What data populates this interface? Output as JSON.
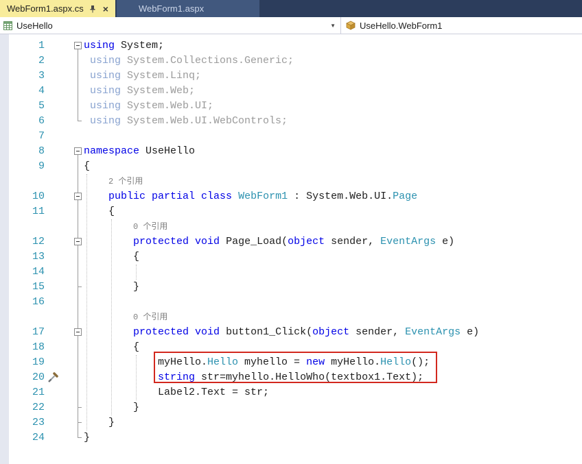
{
  "tab_bar": {
    "tabs": [
      {
        "label": "WebForm1.aspx.cs",
        "active": true
      },
      {
        "label": "WebForm1.aspx",
        "active": false
      }
    ],
    "close_glyph": "×"
  },
  "nav_bar": {
    "scope_dropdown": {
      "value": "UseHello",
      "icon": "grid-table-icon",
      "arrow_glyph": "▼"
    },
    "member_dropdown": {
      "value": "UseHello.WebForm1",
      "icon": "class-icon"
    }
  },
  "colors": {
    "active_tab_bg": "#F8EC9C",
    "tab_strip_bg": "#2C3D5C",
    "inactive_tab_bg": "#41587E",
    "line_number": "#2B91AF",
    "keyword": "#0000E6",
    "type_name": "#2B91AF",
    "plain_text": "#1E1E1E",
    "dimmed_using": "#9B9B9B",
    "codelens_text": "#808080",
    "highlight_border": "#D2281E"
  },
  "editor": {
    "codelens_labels": [
      "2 个引用",
      "0 个引用",
      "0 个引用"
    ],
    "rows": [
      {
        "n": "1",
        "o": 1,
        "t": [
          [
            "kw",
            "using"
          ],
          [
            "pl",
            " System;"
          ]
        ]
      },
      {
        "n": "2",
        "t": [
          [
            "dkw",
            " using"
          ],
          [
            "dim",
            " System.Collections.Generic;"
          ]
        ]
      },
      {
        "n": "3",
        "t": [
          [
            "dkw",
            " using"
          ],
          [
            "dim",
            " System.Linq;"
          ]
        ]
      },
      {
        "n": "4",
        "t": [
          [
            "dkw",
            " using"
          ],
          [
            "dim",
            " System.Web;"
          ]
        ]
      },
      {
        "n": "5",
        "t": [
          [
            "dkw",
            " using"
          ],
          [
            "dim",
            " System.Web.UI;"
          ]
        ]
      },
      {
        "n": "6",
        "t": [
          [
            "dkw",
            " using"
          ],
          [
            "dim",
            " System.Web.UI.WebControls;"
          ]
        ]
      },
      {
        "n": "7",
        "t": []
      },
      {
        "n": "8",
        "o": 1,
        "t": [
          [
            "kw",
            "namespace"
          ],
          [
            "pl",
            " UseHello"
          ]
        ]
      },
      {
        "n": "9",
        "t": [
          [
            "pl",
            "{"
          ]
        ]
      },
      {
        "ind": 4,
        "t": [
          [
            "lens",
            "2 个引用"
          ]
        ]
      },
      {
        "n": "10",
        "o": 1,
        "t": [
          [
            "pl",
            "    "
          ],
          [
            "kw",
            "public partial class"
          ],
          [
            "pl",
            " "
          ],
          [
            "ty",
            "WebForm1"
          ],
          [
            "pl",
            " : System.Web.UI."
          ],
          [
            "ty",
            "Page"
          ]
        ]
      },
      {
        "n": "11",
        "t": [
          [
            "pl",
            "    {"
          ]
        ]
      },
      {
        "ind": 8,
        "t": [
          [
            "lens",
            "0 个引用"
          ]
        ]
      },
      {
        "n": "12",
        "o": 1,
        "t": [
          [
            "pl",
            "        "
          ],
          [
            "kw",
            "protected"
          ],
          [
            "pl",
            " "
          ],
          [
            "kw",
            "void"
          ],
          [
            "pl",
            " Page_Load("
          ],
          [
            "kw",
            "object"
          ],
          [
            "pl",
            " sender, "
          ],
          [
            "ty",
            "EventArgs"
          ],
          [
            "pl",
            " e)"
          ]
        ]
      },
      {
        "n": "13",
        "t": [
          [
            "pl",
            "        {"
          ]
        ]
      },
      {
        "n": "14",
        "t": []
      },
      {
        "n": "15",
        "t": [
          [
            "pl",
            "        }"
          ]
        ]
      },
      {
        "n": "16",
        "t": []
      },
      {
        "ind": 8,
        "t": [
          [
            "lens",
            "0 个引用"
          ]
        ]
      },
      {
        "n": "17",
        "o": 1,
        "t": [
          [
            "pl",
            "        "
          ],
          [
            "kw",
            "protected"
          ],
          [
            "pl",
            " "
          ],
          [
            "kw",
            "void"
          ],
          [
            "pl",
            " button1_Click("
          ],
          [
            "kw",
            "object"
          ],
          [
            "pl",
            " sender, "
          ],
          [
            "ty",
            "EventArgs"
          ],
          [
            "pl",
            " e)"
          ]
        ]
      },
      {
        "n": "18",
        "t": [
          [
            "pl",
            "        {"
          ]
        ]
      },
      {
        "n": "19",
        "t": [
          [
            "pl",
            "            myHello."
          ],
          [
            "ty",
            "Hello"
          ],
          [
            "pl",
            " myhello = "
          ],
          [
            "kw",
            "new"
          ],
          [
            "pl",
            " myHello."
          ],
          [
            "ty",
            "Hello"
          ],
          [
            "pl",
            "();"
          ]
        ]
      },
      {
        "n": "20",
        "icon": 1,
        "t": [
          [
            "pl",
            "            "
          ],
          [
            "kw",
            "string"
          ],
          [
            "pl",
            " str=myhello.HelloWho(textbox1.Text);"
          ]
        ]
      },
      {
        "n": "21",
        "t": [
          [
            "pl",
            "            Label2.Text = str;"
          ]
        ]
      },
      {
        "n": "22",
        "t": [
          [
            "pl",
            "        }"
          ]
        ]
      },
      {
        "n": "23",
        "t": [
          [
            "pl",
            "    }"
          ]
        ]
      },
      {
        "n": "24",
        "t": [
          [
            "pl",
            "}"
          ]
        ]
      }
    ]
  }
}
